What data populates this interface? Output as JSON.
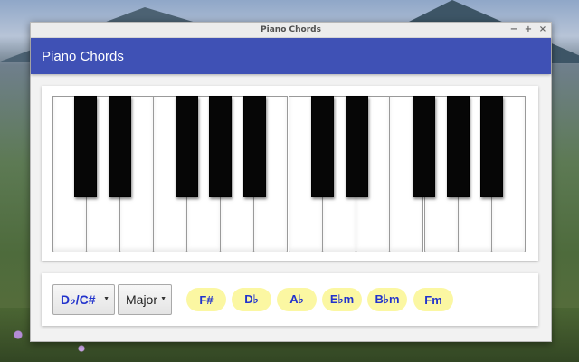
{
  "window": {
    "title": "Piano Chords",
    "controls": {
      "minimize": "−",
      "maximize": "+",
      "close": "×"
    }
  },
  "appbar": {
    "title": "Piano Chords"
  },
  "keyboard": {
    "white_key_count": 14,
    "black_key_count": 10,
    "key_colors": {
      "white": "#ffffff",
      "black": "#060606"
    }
  },
  "controls": {
    "root_select": {
      "value": "D♭/C#"
    },
    "quality_select": {
      "value": "Major"
    },
    "chords": [
      "F#",
      "D♭",
      "A♭",
      "E♭m",
      "B♭m",
      "Fm"
    ]
  },
  "colors": {
    "accent": "#3f51b5",
    "chord_pill": "#fbf7a2",
    "chord_text": "#2233cc"
  }
}
